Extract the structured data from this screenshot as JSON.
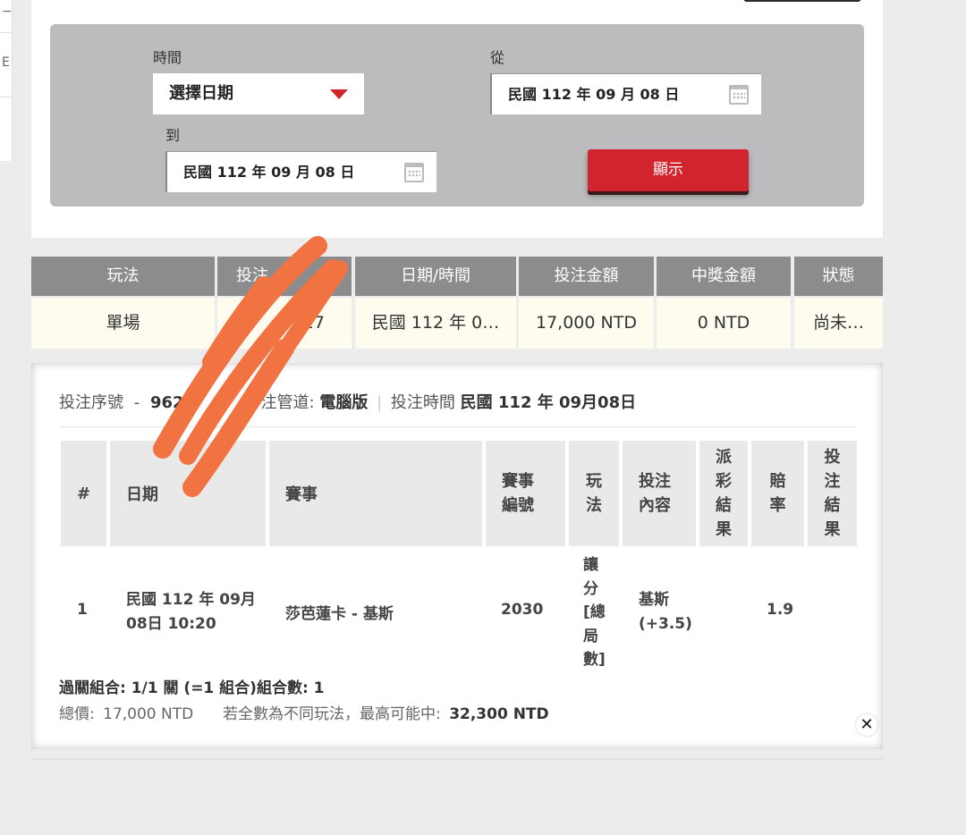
{
  "left_panel": {
    "glyphs": [
      "−",
      "E"
    ]
  },
  "filter": {
    "time_label": "時間",
    "time_select_value": "選擇日期",
    "from_label": "從",
    "from_date": "民國 112 年 09 月 08 日",
    "to_label": "到",
    "to_date": "民國 112 年 09 月 08 日",
    "show_button": "顯示"
  },
  "summary_table": {
    "headers": [
      "玩法",
      "投注",
      "日期/時間",
      "投注金額",
      "中獎金額",
      "狀態"
    ],
    "row": [
      "單場",
      "27",
      "民國 112 年 0…",
      "17,000 NTD",
      "0 NTD",
      "尚未…"
    ]
  },
  "detail": {
    "meta": {
      "serial_label": "投注序號",
      "serial_value": "962",
      "serial_tail": "7",
      "channel_label": "注管道:",
      "channel_value": "電腦版",
      "time_label": "投注時間",
      "time_value": "民國 112 年 09月08日"
    },
    "headers": {
      "num": "#",
      "date": "日期",
      "match": "賽事",
      "match_no": [
        "賽事",
        "編號"
      ],
      "play": [
        "玩",
        "法"
      ],
      "bet_content": [
        "投注",
        "內容"
      ],
      "payout_result": [
        "派",
        "彩",
        "結",
        "果"
      ],
      "odds": [
        "賠",
        "率"
      ],
      "bet_result": [
        "投",
        "注",
        "結",
        "果"
      ]
    },
    "row": {
      "num": "1",
      "date_line1": "民國 112 年 09月",
      "date_line2": "08日 10:20",
      "match": "莎芭蓮卡 - 基斯",
      "match_no": "2030",
      "play_lines": [
        "讓",
        "分",
        "[總",
        "局",
        "數]"
      ],
      "bet_line1": "基斯",
      "bet_line2": "(+3.5)",
      "odds": "1.9"
    },
    "combo": "過關組合: 1/1 關 (=1 組合)組合數: 1",
    "total_label": "總價:",
    "total_value": "17,000 NTD",
    "max_label": "若全數為不同玩法，最高可能中:",
    "max_value": "32,300 NTD",
    "close_icon": "close-icon"
  },
  "colors": {
    "accent_red": "#d1242e",
    "header_gray": "#8c8c8e",
    "filter_bg": "#bcbcbe",
    "row_bg": "#fdfcef",
    "scribble": "#f27342"
  }
}
